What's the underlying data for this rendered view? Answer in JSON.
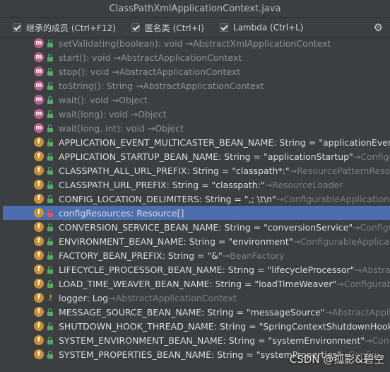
{
  "window": {
    "title": "ClassPathXmlApplicationContext.java"
  },
  "filters": [
    {
      "label": "继承的成员 (Ctrl+F12)",
      "checked": true
    },
    {
      "label": "匿名类 (Ctrl+I)",
      "checked": true
    },
    {
      "label": "Lambda (Ctrl+L)",
      "checked": true
    }
  ],
  "members": [
    {
      "type": "m",
      "vis": "pub",
      "inherited": true,
      "sig": "setValidating(boolean): void →AbstractXmlApplicationContext"
    },
    {
      "type": "m",
      "vis": "pub",
      "inherited": true,
      "sig": "start(): void →AbstractApplicationContext"
    },
    {
      "type": "m",
      "vis": "pub",
      "inherited": true,
      "sig": "stop(): void →AbstractApplicationContext"
    },
    {
      "type": "m",
      "vis": "pub",
      "inherited": true,
      "sig": "toString(): String →AbstractApplicationContext"
    },
    {
      "type": "m",
      "vis": "pub",
      "inherited": true,
      "sig": "wait(): void →Object"
    },
    {
      "type": "m",
      "vis": "pub",
      "inherited": true,
      "sig": "wait(long): void →Object"
    },
    {
      "type": "m",
      "vis": "pub",
      "inherited": true,
      "sig": "wait(long, int): void →Object"
    },
    {
      "type": "f",
      "vis": "pub",
      "inherited": false,
      "sig": "APPLICATION_EVENT_MULTICASTER_BEAN_NAME: String = \"applicationEventMu",
      "hint": ""
    },
    {
      "type": "f",
      "vis": "pub",
      "inherited": false,
      "sig": "APPLICATION_STARTUP_BEAN_NAME: String = \"applicationStartup\"",
      "hint": " →Configura"
    },
    {
      "type": "f",
      "vis": "pub",
      "inherited": false,
      "sig": "CLASSPATH_ALL_URL_PREFIX: String = \"classpath*:\"",
      "hint": " →ResourcePatternResolver"
    },
    {
      "type": "f",
      "vis": "pub",
      "inherited": false,
      "sig": "CLASSPATH_URL_PREFIX: String = \"classpath:\"",
      "hint": " →ResourceLoader"
    },
    {
      "type": "f",
      "vis": "pub",
      "inherited": false,
      "sig": "CONFIG_LOCATION_DELIMITERS: String = \",; \\t\\n\"",
      "hint": " →ConfigurableApplicationCo"
    },
    {
      "type": "f",
      "vis": "priv",
      "inherited": false,
      "selected": true,
      "sig": "configResources: Resource[]",
      "hint": ""
    },
    {
      "type": "f",
      "vis": "pub",
      "inherited": false,
      "sig": "CONVERSION_SERVICE_BEAN_NAME: String = \"conversionService\"",
      "hint": " →Configurab"
    },
    {
      "type": "f",
      "vis": "pub",
      "inherited": false,
      "sig": "ENVIRONMENT_BEAN_NAME: String = \"environment\"",
      "hint": " →ConfigurableApplicatio"
    },
    {
      "type": "f",
      "vis": "pub",
      "inherited": false,
      "sig": "FACTORY_BEAN_PREFIX: String = \"&\"",
      "hint": " →BeanFactory"
    },
    {
      "type": "f",
      "vis": "pub",
      "inherited": false,
      "sig": "LIFECYCLE_PROCESSOR_BEAN_NAME: String = \"lifecycleProcessor\"",
      "hint": " →AbstractAp"
    },
    {
      "type": "f",
      "vis": "pub",
      "inherited": false,
      "sig": "LOAD_TIME_WEAVER_BEAN_NAME: String = \"loadTimeWeaver\"",
      "hint": " →ConfigurableA"
    },
    {
      "type": "f",
      "vis": "key",
      "inherited": false,
      "sig": "logger: Log",
      "hint": " →AbstractApplicationContext"
    },
    {
      "type": "f",
      "vis": "pub",
      "inherited": false,
      "sig": "MESSAGE_SOURCE_BEAN_NAME: String = \"messageSource\"",
      "hint": " →AbstractApplicati"
    },
    {
      "type": "f",
      "vis": "pub",
      "inherited": false,
      "sig": "SHUTDOWN_HOOK_THREAD_NAME: String = \"SpringContextShutdownHook\"",
      "hint": " →Ab"
    },
    {
      "type": "f",
      "vis": "pub",
      "inherited": false,
      "sig": "SYSTEM_ENVIRONMENT_BEAN_NAME: String = \"systemEnvironment\"",
      "hint": " →Configu"
    },
    {
      "type": "f",
      "vis": "pub",
      "inherited": false,
      "sig": "SYSTEM_PROPERTIES_BEAN_NAME: String = \"systemProperties\"",
      "hint": " →Configu"
    }
  ],
  "watermark": "CSDN @孤影&碧空",
  "colors": {
    "selection": "#4b6eaf",
    "method_icon": "#b85f8c",
    "field_icon": "#c99133",
    "public_lock": "#59a869",
    "private_lock": "#e05555"
  }
}
